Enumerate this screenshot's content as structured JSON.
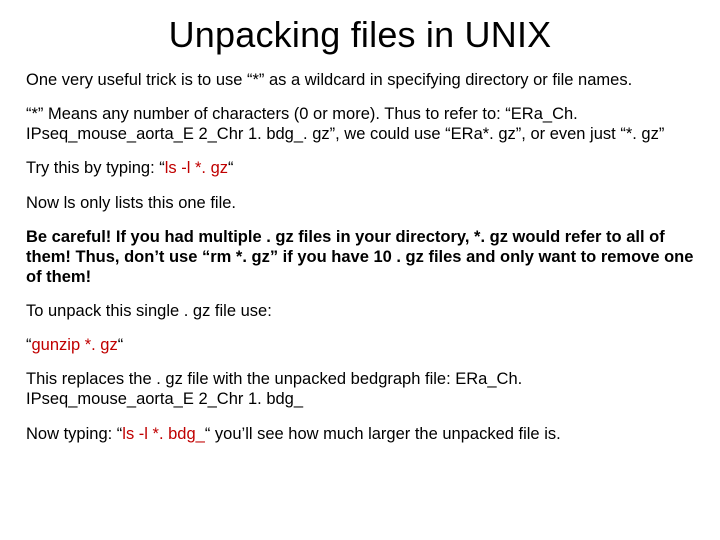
{
  "title": "Unpacking files in UNIX",
  "p1": "One very useful trick is to use “*” as a wildcard in specifying directory or file names.",
  "p2": "“*” Means any number of characters (0 or more). Thus to refer to: “ERa_Ch. IPseq_mouse_aorta_E 2_Chr 1. bdg_. gz”, we could use “ERa*. gz”, or even just “*. gz”",
  "p3a": "Try this by typing: “",
  "p3cmd": "ls -l *. gz",
  "p3b": "“",
  "p4": "Now ls only lists this one file.",
  "p5": "Be careful! If you had multiple . gz files in your directory, *. gz would refer to all of them! Thus, don’t use “rm *. gz” if you have 10 . gz files and only want to remove one of them!",
  "p6": "To unpack this single . gz file use:",
  "p7a": "“",
  "p7cmd": "gunzip *. gz",
  "p7b": "“",
  "p8": "This replaces the . gz file with the unpacked bedgraph file: ERa_Ch. IPseq_mouse_aorta_E 2_Chr 1. bdg_",
  "p9a": "Now typing: “",
  "p9cmd": "ls -l *. bdg_",
  "p9b": "“ you’ll see how much larger the unpacked file is."
}
